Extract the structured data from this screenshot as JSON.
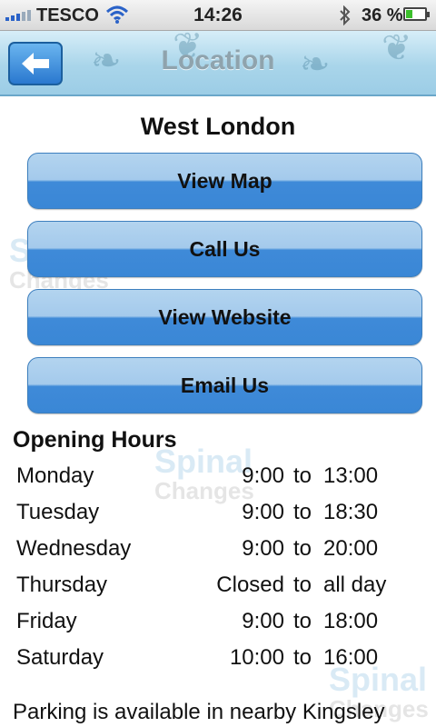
{
  "status_bar": {
    "carrier": "TESCO",
    "time": "14:26",
    "battery": "36 %",
    "battery_level": 0.36
  },
  "nav": {
    "title": "Location",
    "back_icon": "arrow-left-icon"
  },
  "watermark": {
    "word1": "Spinal",
    "word2": "Changes"
  },
  "location": {
    "name": "West London"
  },
  "actions": [
    {
      "label": "View Map"
    },
    {
      "label": "Call Us"
    },
    {
      "label": "View Website"
    },
    {
      "label": "Email Us"
    }
  ],
  "hours": {
    "title": "Opening Hours",
    "rows": [
      {
        "day": "Monday",
        "open": "9:00",
        "sep": "to",
        "close": "13:00"
      },
      {
        "day": "Tuesday",
        "open": "9:00",
        "sep": "to",
        "close": "18:30"
      },
      {
        "day": "Wednesday",
        "open": "9:00",
        "sep": "to",
        "close": "20:00"
      },
      {
        "day": "Thursday",
        "open": "Closed",
        "sep": "to",
        "close": "all day"
      },
      {
        "day": "Friday",
        "open": "9:00",
        "sep": "to",
        "close": "18:00"
      },
      {
        "day": "Saturday",
        "open": "10:00",
        "sep": "to",
        "close": "16:00"
      }
    ]
  },
  "parking": {
    "text": "Parking is available in nearby Kingsley"
  },
  "colors": {
    "button_blue": "#3a87d6",
    "nav_blue": "#a9d5ea",
    "battery_green": "#3cbf2c"
  }
}
